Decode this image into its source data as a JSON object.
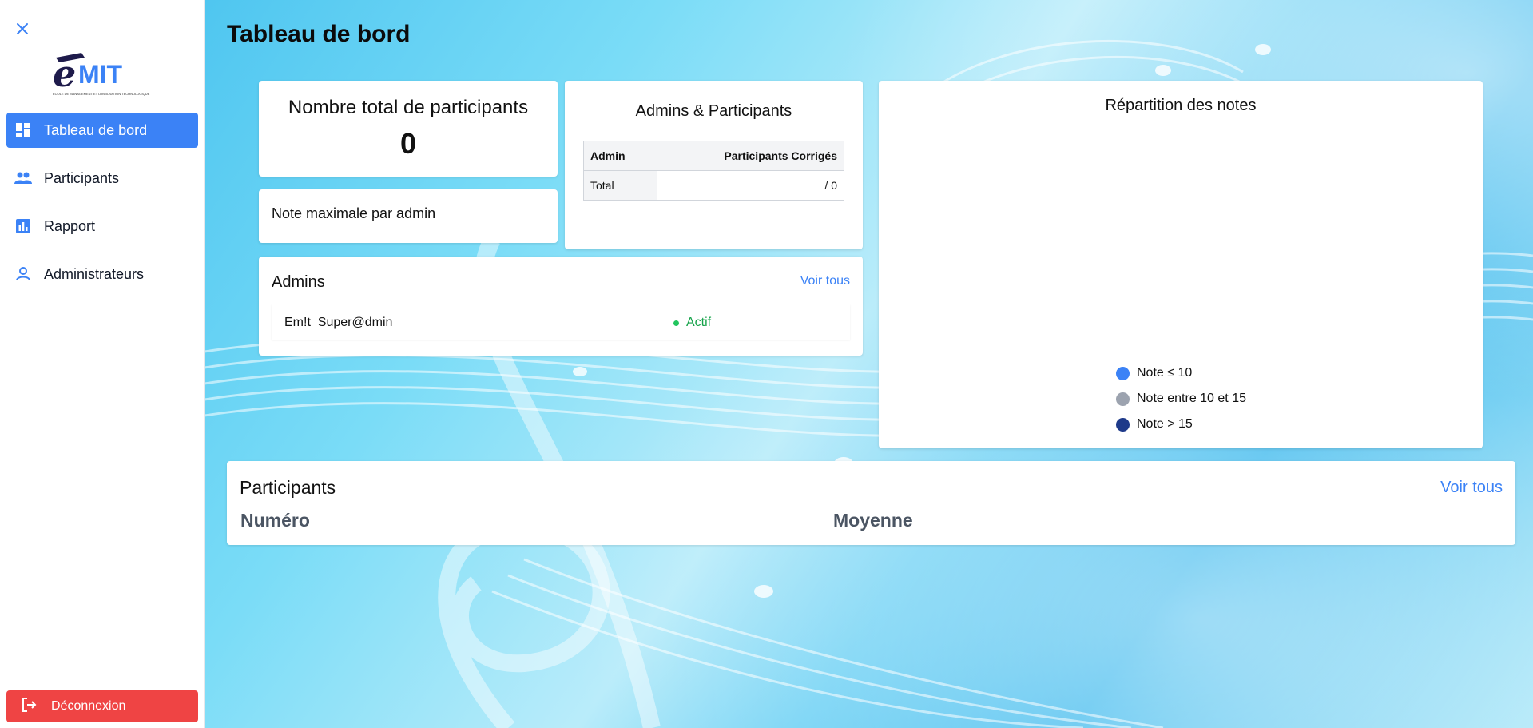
{
  "sidebar": {
    "logo_text": "eMIT",
    "logo_subtitle": "ECOLE DE MANAGEMENT ET D'INNOVATION TECHNOLOGIQUE",
    "items": [
      {
        "label": "Tableau de bord",
        "icon": "dashboard-icon",
        "active": true
      },
      {
        "label": "Participants",
        "icon": "users-icon",
        "active": false
      },
      {
        "label": "Rapport",
        "icon": "bar-chart-icon",
        "active": false
      },
      {
        "label": "Administrateurs",
        "icon": "user-icon",
        "active": false
      }
    ],
    "logout_label": "Déconnexion"
  },
  "header": {
    "title": "Tableau de bord"
  },
  "stats": {
    "total_label": "Nombre total de participants",
    "total_value": "0",
    "max_note_label": "Note maximale par admin"
  },
  "admins_participants": {
    "title": "Admins & Participants",
    "headers": [
      "Admin",
      "Participants Corrigés"
    ],
    "rows": [
      [
        "Total",
        "/ 0"
      ]
    ]
  },
  "admins": {
    "title": "Admins",
    "see_all": "Voir tous",
    "list": [
      {
        "name": "Em!t_Super@dmin",
        "status": "Actif"
      }
    ]
  },
  "chart": {
    "title": "Répartition des notes",
    "legend": [
      {
        "label": "Note ≤ 10",
        "color": "#3b82f6"
      },
      {
        "label": "Note entre 10 et 15",
        "color": "#9ca3af"
      },
      {
        "label": "Note > 15",
        "color": "#1e3a8a"
      }
    ]
  },
  "chart_data": {
    "type": "pie",
    "title": "Répartition des notes",
    "categories": [
      "Note ≤ 10",
      "Note entre 10 et 15",
      "Note > 15"
    ],
    "values": [
      0,
      0,
      0
    ],
    "legend": "bottom"
  },
  "participants": {
    "title": "Participants",
    "see_all": "Voir tous",
    "columns": [
      "Numéro",
      "Moyenne"
    ]
  },
  "colors": {
    "accent": "#3b82f6",
    "danger": "#ef4444",
    "success": "#16a34a"
  }
}
